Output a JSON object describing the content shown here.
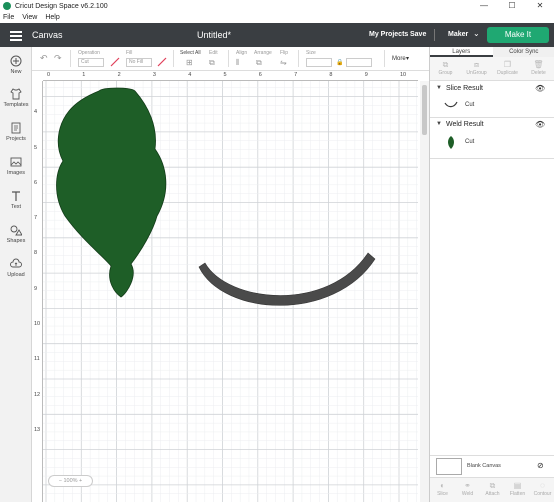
{
  "window": {
    "title": "Cricut Design Space  v6.2.100",
    "controls": [
      "—",
      "☐",
      "✕"
    ]
  },
  "menu": [
    "File",
    "View",
    "Help"
  ],
  "header": {
    "section": "Canvas",
    "doc_title": "Untitled*",
    "my_projects": "My Projects",
    "save": "Save",
    "machine": "Maker",
    "make_it": "Make It"
  },
  "left_tools": [
    {
      "label": "New",
      "icon": "plus-icon"
    },
    {
      "label": "Templates",
      "icon": "shirt-icon"
    },
    {
      "label": "Projects",
      "icon": "projects-icon"
    },
    {
      "label": "Images",
      "icon": "image-icon"
    },
    {
      "label": "Text",
      "icon": "text-icon"
    },
    {
      "label": "Shapes",
      "icon": "shapes-icon"
    },
    {
      "label": "Upload",
      "icon": "cloud-upload-icon"
    }
  ],
  "edit_toolbar": {
    "operation_label": "Operation",
    "operation_value": "Cut",
    "fill_label": "Fill",
    "fill_value": "No Fill",
    "select_all": "Select All",
    "edit": "Edit",
    "align": "Align",
    "arrange": "Arrange",
    "flip": "Flip",
    "size": "Size",
    "more": "More"
  },
  "ruler": {
    "h_ticks": [
      "0",
      "1",
      "2",
      "3",
      "4",
      "5",
      "6",
      "7",
      "8",
      "9",
      "10"
    ],
    "v_ticks": [
      "2",
      "3",
      "4",
      "5",
      "6",
      "7",
      "8",
      "9",
      "10",
      "11",
      "12",
      "13"
    ]
  },
  "canvas": {
    "zoom": "100%",
    "colors": {
      "green": "#1e5e27",
      "dark": "#4a4a4a"
    }
  },
  "layers_panel": {
    "tabs": [
      "Layers",
      "Color Sync"
    ],
    "actions_top": [
      "Group",
      "UnGroup",
      "Duplicate",
      "Delete"
    ],
    "groups": [
      {
        "name": "Slice Result",
        "layers": [
          {
            "label": "Cut",
            "color": "#3b3b3b"
          }
        ]
      },
      {
        "name": "Weld Result",
        "layers": [
          {
            "label": "Cut",
            "color": "#1e5e27"
          }
        ]
      }
    ],
    "blank_canvas": "Blank Canvas",
    "actions_bottom": [
      "Slice",
      "Weld",
      "Attach",
      "Flatten",
      "Contour"
    ]
  }
}
